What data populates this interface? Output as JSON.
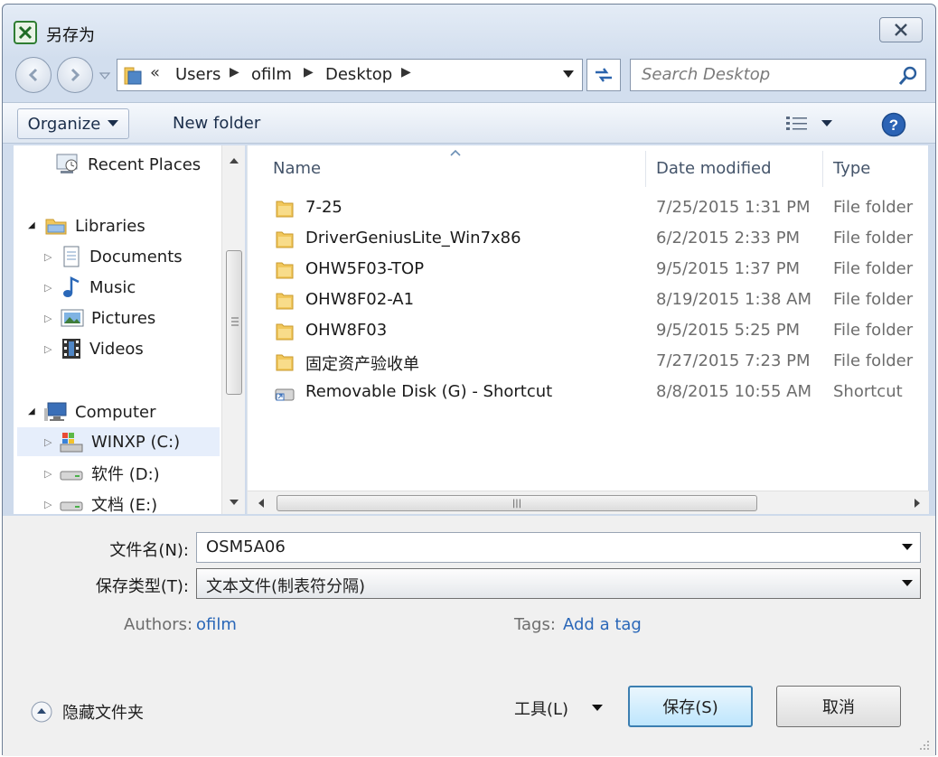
{
  "window": {
    "title": "另存为"
  },
  "address": {
    "overflow": "«",
    "crumbs": [
      "Users",
      "ofilm",
      "Desktop"
    ]
  },
  "search": {
    "placeholder": "Search Desktop"
  },
  "toolbar": {
    "organize": "Organize",
    "new_folder": "New folder"
  },
  "nav": {
    "recent": "Recent Places",
    "libraries": "Libraries",
    "documents": "Documents",
    "music": "Music",
    "pictures": "Pictures",
    "videos": "Videos",
    "computer": "Computer",
    "drive_c": "WINXP (C:)",
    "drive_d": "软件 (D:)",
    "drive_e": "文档 (E:)"
  },
  "columns": {
    "name": "Name",
    "date": "Date modified",
    "type": "Type"
  },
  "files": [
    {
      "name": "7-25",
      "date": "7/25/2015 1:31 PM",
      "type": "File folder",
      "icon": "folder-icon"
    },
    {
      "name": "DriverGeniusLite_Win7x86",
      "date": "6/2/2015 2:33 PM",
      "type": "File folder",
      "icon": "folder-icon"
    },
    {
      "name": "OHW5F03-TOP",
      "date": "9/5/2015 1:37 PM",
      "type": "File folder",
      "icon": "folder-icon"
    },
    {
      "name": "OHW8F02-A1",
      "date": "8/19/2015 1:38 AM",
      "type": "File folder",
      "icon": "folder-icon"
    },
    {
      "name": "OHW8F03",
      "date": "9/5/2015 5:25 PM",
      "type": "File folder",
      "icon": "folder-icon"
    },
    {
      "name": "固定资产验收单",
      "date": "7/27/2015 7:23 PM",
      "type": "File folder",
      "icon": "folder-icon"
    },
    {
      "name": "Removable Disk (G) - Shortcut",
      "date": "8/8/2015 10:55 AM",
      "type": "Shortcut",
      "icon": "shortcut-icon"
    }
  ],
  "form": {
    "filename_label": "文件名(N):",
    "filename_value": "OSM5A06",
    "type_label": "保存类型(T):",
    "type_value": "文本文件(制表符分隔)",
    "authors_label": "Authors:",
    "authors_value": "ofilm",
    "tags_label": "Tags:",
    "tags_value": "Add a tag",
    "hide_folders": "隐藏文件夹",
    "tools": "工具(L)",
    "save": "保存(S)",
    "cancel": "取消"
  },
  "colors": {
    "accent": "#2a67b8",
    "folder": "#f1c75b",
    "primary_border": "#3c7fb1"
  }
}
